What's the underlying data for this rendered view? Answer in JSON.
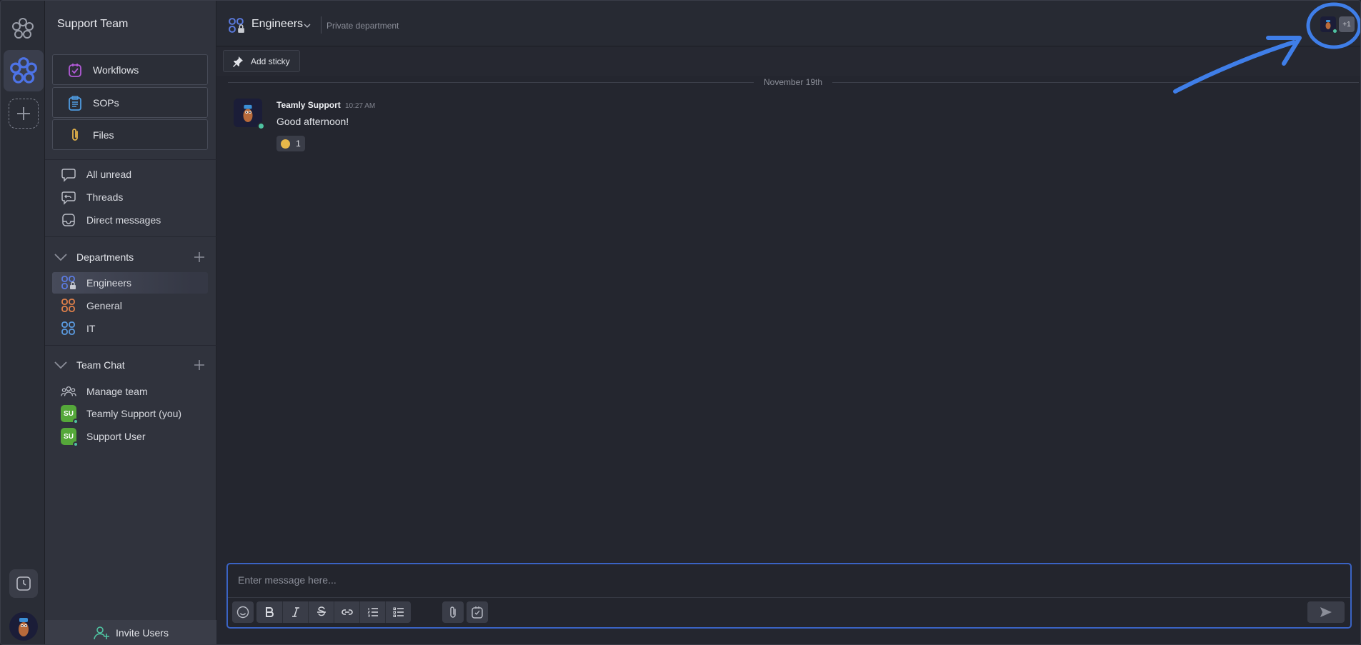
{
  "workspace": {
    "team_name": "Support Team",
    "tools": [
      {
        "label": "Workflows",
        "icon": "workflows-icon"
      },
      {
        "label": "SOPs",
        "icon": "sop-clipboard-icon"
      },
      {
        "label": "Files",
        "icon": "paperclip-icon"
      }
    ],
    "nav": [
      {
        "label": "All unread",
        "icon": "chat-bubble-icon"
      },
      {
        "label": "Threads",
        "icon": "threads-icon"
      },
      {
        "label": "Direct messages",
        "icon": "inbox-icon"
      }
    ],
    "departments": {
      "title": "Departments",
      "items": [
        {
          "label": "Engineers",
          "color": "#5b7be0",
          "private": true,
          "active": true
        },
        {
          "label": "General",
          "color": "#e0804a",
          "private": false,
          "active": false
        },
        {
          "label": "IT",
          "color": "#5b9be0",
          "private": false,
          "active": false
        }
      ]
    },
    "team_chat": {
      "title": "Team Chat",
      "manage_label": "Manage team",
      "members": [
        {
          "initials": "SU",
          "label": "Teamly Support (you)",
          "online": true
        },
        {
          "initials": "SU",
          "label": "Support User",
          "online": true
        }
      ]
    },
    "invite_label": "Invite Users"
  },
  "channel": {
    "name": "Engineers",
    "subtitle": "Private department",
    "member_overflow": "+1",
    "add_sticky_label": "Add sticky"
  },
  "messages": {
    "date_divider": "November 19th",
    "items": [
      {
        "author": "Teamly Support",
        "time": "10:27 AM",
        "text": "Good afternoon!",
        "reaction_count": "1"
      }
    ]
  },
  "composer": {
    "placeholder": "Enter message here...",
    "toolbar": [
      "emoji-icon",
      "bold-icon",
      "italic-icon",
      "strikethrough-icon",
      "link-icon",
      "ordered-list-icon",
      "bullet-list-icon",
      "attach-icon",
      "task-icon",
      "send-icon"
    ]
  },
  "colors": {
    "accent": "#3a63c4",
    "online": "#4fc3a1",
    "annotation": "#3f7ee8",
    "badge_green": "#55a83a"
  }
}
